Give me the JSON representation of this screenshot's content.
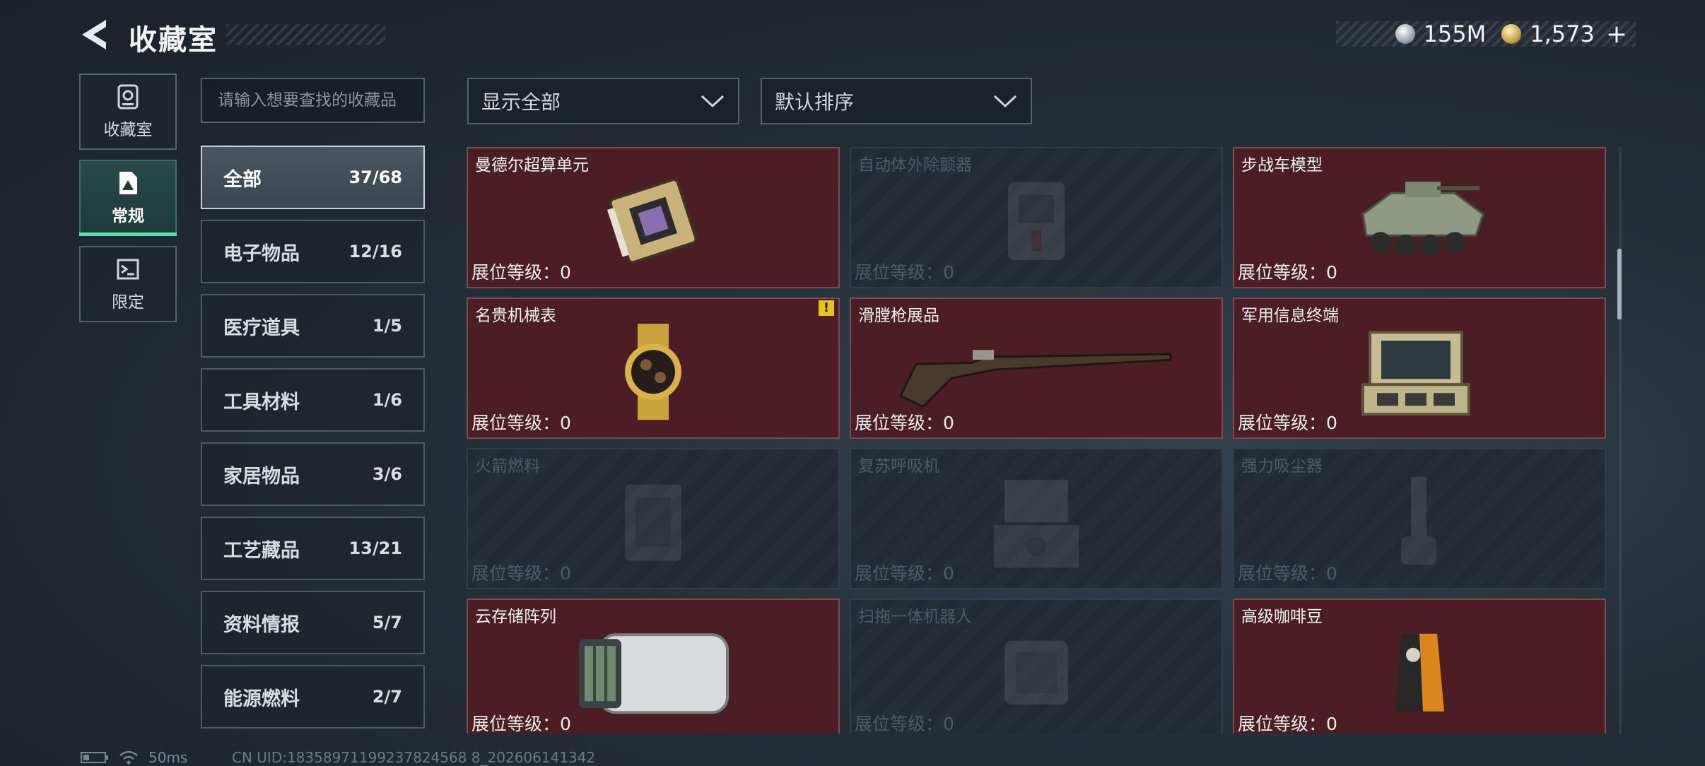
{
  "header": {
    "title": "收藏室",
    "currencies": [
      {
        "icon": "silver-coin-icon",
        "value": "155M"
      },
      {
        "icon": "gold-coin-icon",
        "value": "1,573"
      }
    ],
    "plus": "+"
  },
  "nav": [
    {
      "label": "收藏室",
      "icon": "trophy-case-icon"
    },
    {
      "label": "常规",
      "icon": "collection-icon",
      "active": true
    },
    {
      "label": "限定",
      "icon": "limited-icon"
    }
  ],
  "search": {
    "placeholder": "请输入想要查找的收藏品"
  },
  "categories": [
    {
      "name": "全部",
      "count": "37/68",
      "active": true
    },
    {
      "name": "电子物品",
      "count": "12/16"
    },
    {
      "name": "医疗道具",
      "count": "1/5"
    },
    {
      "name": "工具材料",
      "count": "1/6"
    },
    {
      "name": "家居物品",
      "count": "3/6"
    },
    {
      "name": "工艺藏品",
      "count": "13/21"
    },
    {
      "name": "资料情报",
      "count": "5/7"
    },
    {
      "name": "能源燃料",
      "count": "2/7"
    }
  ],
  "filters": {
    "show": "显示全部",
    "sort": "默认排序"
  },
  "level_label": "展位等级：0",
  "items": [
    {
      "name": "曼德尔超算单元",
      "owned": true,
      "art": "circuit-board-icon"
    },
    {
      "name": "自动体外除颤器",
      "owned": false,
      "art": "defibrillator-icon"
    },
    {
      "name": "步战车模型",
      "owned": true,
      "art": "ifv-model-icon"
    },
    {
      "name": "名贵机械表",
      "owned": true,
      "art": "watch-icon",
      "warning": "!"
    },
    {
      "name": "滑膛枪展品",
      "owned": true,
      "art": "musket-icon"
    },
    {
      "name": "军用信息终端",
      "owned": true,
      "art": "terminal-case-icon"
    },
    {
      "name": "火箭燃料",
      "owned": false,
      "art": "fuel-canister-icon"
    },
    {
      "name": "复苏呼吸机",
      "owned": false,
      "art": "ventilator-icon"
    },
    {
      "name": "强力吸尘器",
      "owned": false,
      "art": "vacuum-icon"
    },
    {
      "name": "云存储阵列",
      "owned": true,
      "art": "storage-array-icon"
    },
    {
      "name": "扫拖一体机器人",
      "owned": false,
      "art": "robot-vacuum-icon"
    },
    {
      "name": "高级咖啡豆",
      "owned": true,
      "art": "coffee-bag-icon"
    }
  ],
  "footer": {
    "ping": "50ms",
    "uid": "CN UID:18358971199237824568 8_202606141342"
  }
}
